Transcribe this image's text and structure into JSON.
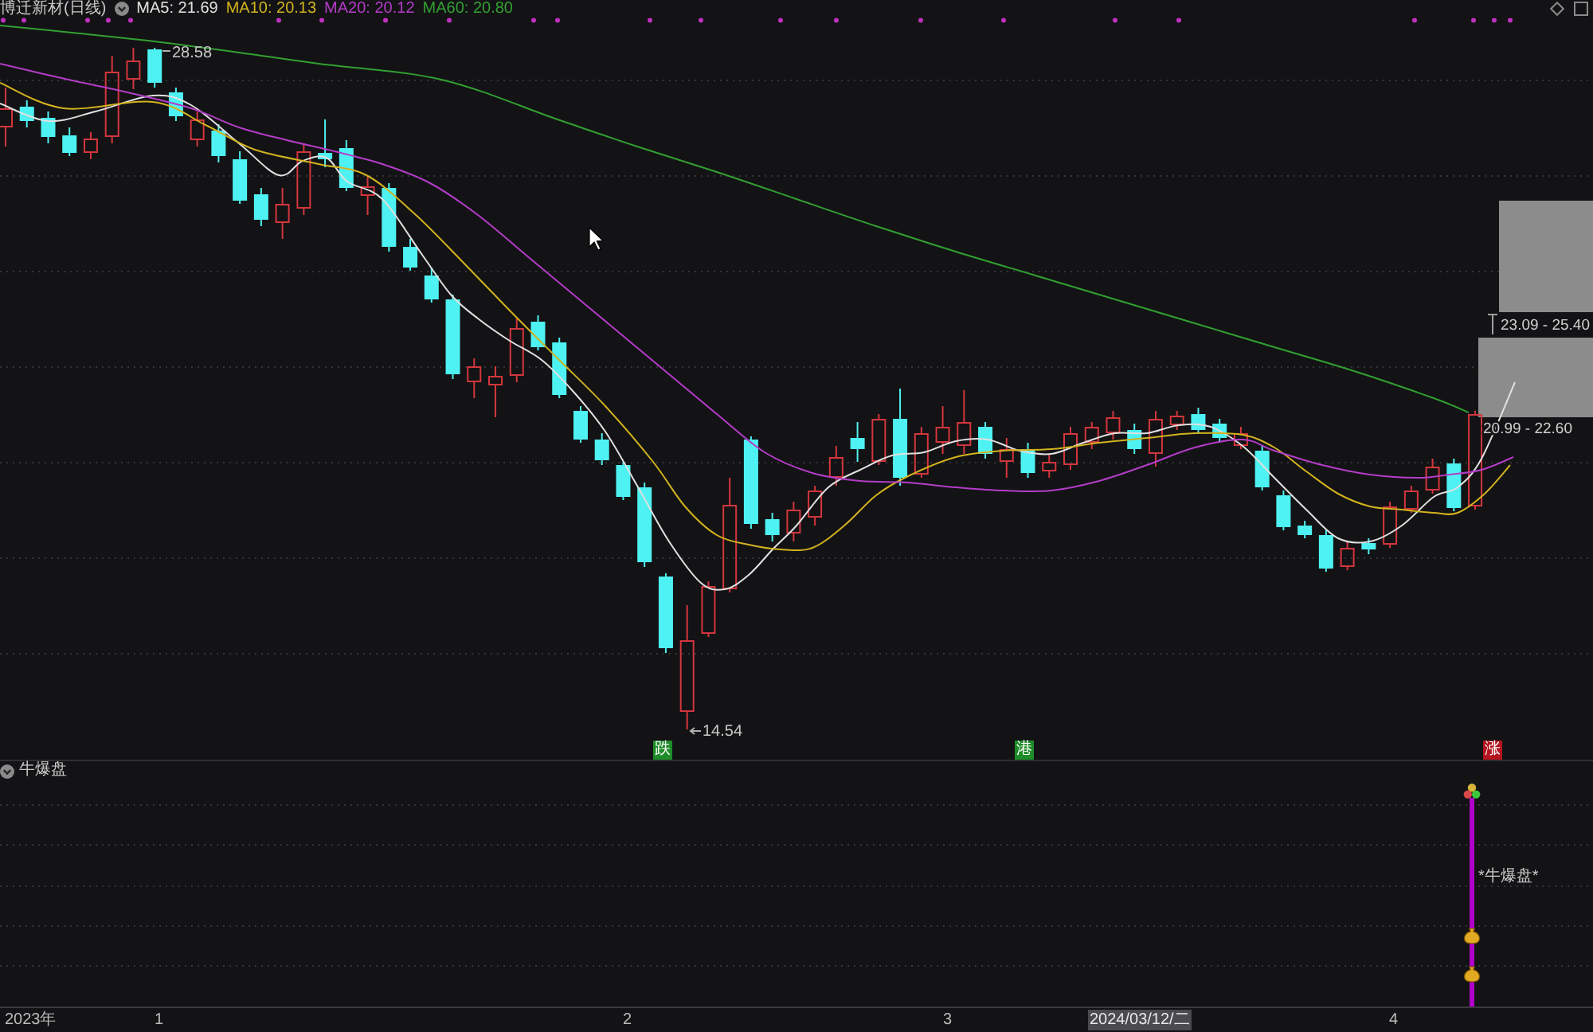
{
  "header": {
    "title": "博迁新材(日线)",
    "indicators": [
      {
        "label": "MA5: 21.69",
        "color": "#e0e0e0"
      },
      {
        "label": "MA10: 20.13",
        "color": "#d2b21e"
      },
      {
        "label": "MA20: 20.12",
        "color": "#b43cc8"
      },
      {
        "label": "MA60: 20.80",
        "color": "#32a032"
      }
    ]
  },
  "main_chart": {
    "high_label": "28.58",
    "low_label": "14.54",
    "zones": [
      {
        "label": "23.09 - 25.40"
      },
      {
        "label": "20.99 - 22.60"
      }
    ],
    "signals": [
      {
        "text": "跌",
        "color": "#1e8c28"
      },
      {
        "text": "港",
        "color": "#1e8c28"
      },
      {
        "text": "涨",
        "color": "#b4141e"
      }
    ]
  },
  "sub_panel": {
    "title": "牛爆盘",
    "annotation": "*牛爆盘*"
  },
  "x_axis": {
    "labels": [
      {
        "text": "2023年",
        "selected": false
      },
      {
        "text": "1",
        "selected": false
      },
      {
        "text": "2",
        "selected": false
      },
      {
        "text": "3",
        "selected": false
      },
      {
        "text": "2024/03/12/二",
        "selected": true
      },
      {
        "text": "4",
        "selected": false
      }
    ]
  }
}
